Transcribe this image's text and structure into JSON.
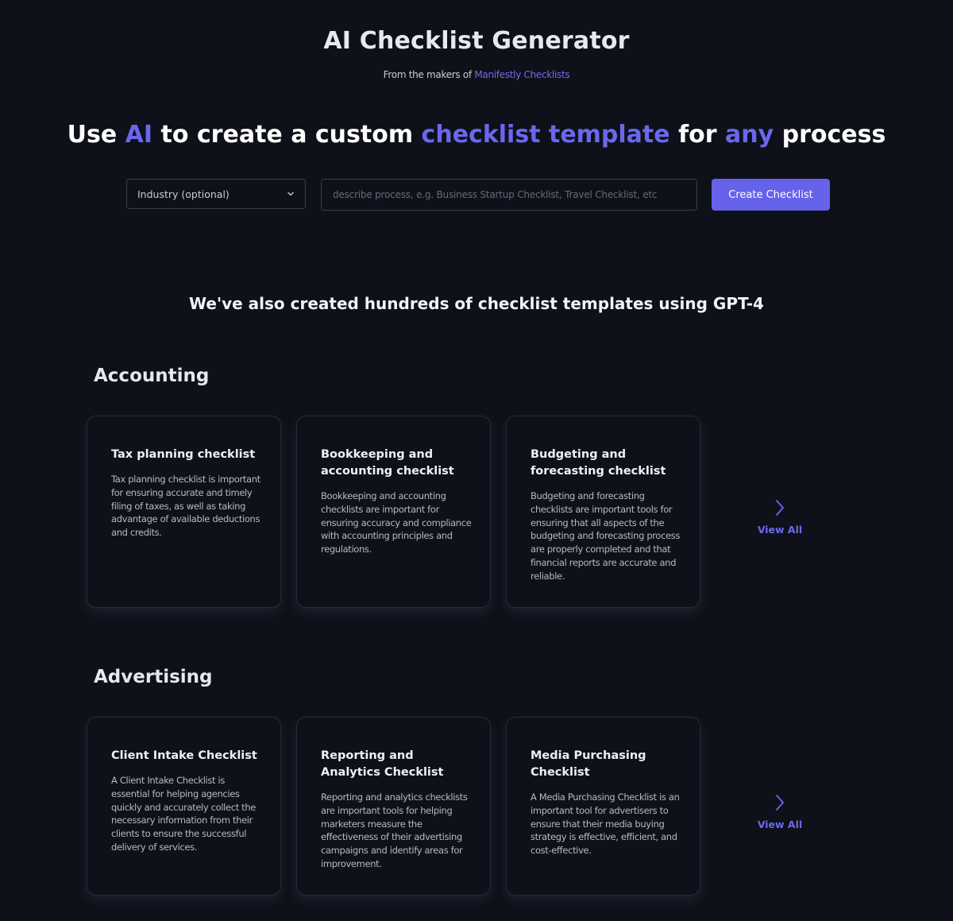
{
  "header": {
    "title": "AI Checklist Generator",
    "subtitle_prefix": "From the makers of",
    "subtitle_link": "Manifestly Checklists"
  },
  "hero": {
    "part1": "Use ",
    "accent1": "AI",
    "part2": " to create a custom ",
    "accent2": "checklist template",
    "part3": " for ",
    "accent3": "any",
    "part4": " process"
  },
  "form": {
    "industry_select": "Industry (optional)",
    "process_placeholder": "describe process, e.g. Business Startup Checklist, Travel Checklist, etc",
    "process_value": "",
    "submit_label": "Create Checklist"
  },
  "templates_heading": "We've also created hundreds of checklist templates using GPT-4",
  "categories": [
    {
      "title": "Accounting",
      "cards": [
        {
          "title": "Tax planning checklist",
          "description": "Tax planning checklist is important for ensuring accurate and timely filing of taxes, as well as taking advantage of available deductions and credits."
        },
        {
          "title": "Bookkeeping and accounting checklist",
          "description": "Bookkeeping and accounting checklists are important for ensuring accuracy and compliance with accounting principles and regulations."
        },
        {
          "title": "Budgeting and forecasting checklist",
          "description": "Budgeting and forecasting checklists are important tools for ensuring that all aspects of the budgeting and forecasting process are properly completed and that financial reports are accurate and reliable."
        }
      ],
      "view_all": "View All"
    },
    {
      "title": "Advertising",
      "cards": [
        {
          "title": "Client Intake Checklist",
          "description": "A Client Intake Checklist is essential for helping agencies quickly and accurately collect the necessary information from their clients to ensure the successful delivery of services."
        },
        {
          "title": "Reporting and Analytics Checklist",
          "description": "Reporting and analytics checklists are important tools for helping marketers measure the effectiveness of their advertising campaigns and identify areas for improvement."
        },
        {
          "title": "Media Purchasing Checklist",
          "description": "A Media Purchasing Checklist is an important tool for advertisers to ensure that their media buying strategy is effective, efficient, and cost-effective."
        }
      ],
      "view_all": "View All"
    }
  ],
  "icons": {
    "select_chevron": "chevron-down-icon",
    "view_all_arrow": "chevron-right-icon"
  },
  "colors": {
    "background": "#0e1119",
    "accent": "#6662ea",
    "text": "#e6e8ee"
  }
}
